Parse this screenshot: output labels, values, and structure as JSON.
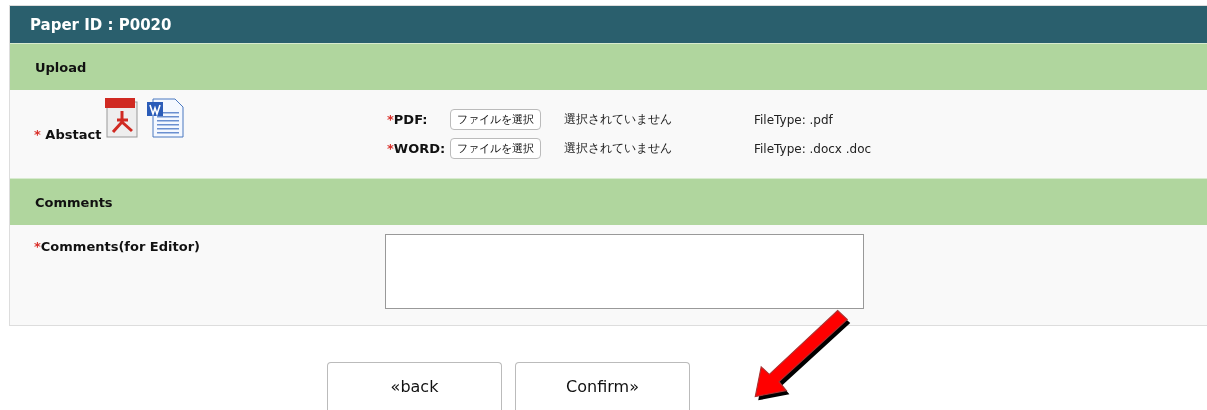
{
  "title": "Paper ID : P0020",
  "upload": {
    "heading": "Upload",
    "label": {
      "mark": "*",
      "text": " Abstact"
    },
    "files": [
      {
        "mark": "*",
        "label": "PDF:",
        "button": "ファイルを選択",
        "status": "選択されていません",
        "filetype": "FileType: .pdf"
      },
      {
        "mark": "*",
        "label": "WORD:",
        "button": "ファイルを選択",
        "status": "選択されていません",
        "filetype": "FileType: .docx .doc"
      }
    ]
  },
  "comments": {
    "heading": "Comments",
    "label": {
      "mark": "*",
      "text": "Comments(for Editor)"
    }
  },
  "buttons": [
    "«back",
    "Confirm»"
  ]
}
